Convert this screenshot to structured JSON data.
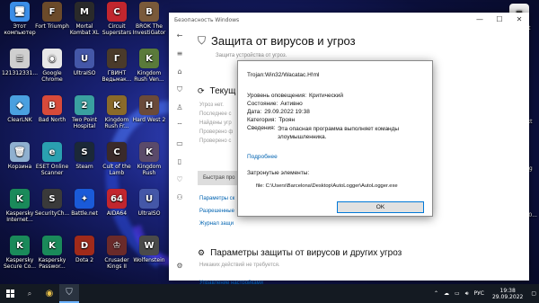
{
  "desktop_icons": [
    {
      "label": "Этот компьютер",
      "glyph": "🖥",
      "color": "#3b8ee8"
    },
    {
      "label": "Fort Triumph",
      "glyph": "F",
      "color": "#6b4a2a"
    },
    {
      "label": "Mortal Kombat XL",
      "glyph": "M",
      "color": "#2a2a2a"
    },
    {
      "label": "Circuit Superstars",
      "glyph": "C",
      "color": "#c2262e"
    },
    {
      "label": "BROK The InvestiGator",
      "glyph": "B",
      "color": "#7a5a3a"
    },
    {
      "label": "121312331...",
      "glyph": "≡",
      "color": "#cfcfcf"
    },
    {
      "label": "Google Chrome",
      "glyph": "◉",
      "color": "#e8e8e8"
    },
    {
      "label": "UltraISO",
      "glyph": "U",
      "color": "#4457a8"
    },
    {
      "label": "ГВИНТ Ведьмак...",
      "glyph": "Г",
      "color": "#4a3a2a"
    },
    {
      "label": "Kingdom Rush Ven...",
      "glyph": "K",
      "color": "#5a7a3a"
    },
    {
      "label": "ClearLNK",
      "glyph": "◆",
      "color": "#4aa0e0"
    },
    {
      "label": "Bad North",
      "glyph": "B",
      "color": "#d84a3a"
    },
    {
      "label": "Two Point Hospital",
      "glyph": "2",
      "color": "#3aa0a0"
    },
    {
      "label": "Kingdom Rush Fr...",
      "glyph": "K",
      "color": "#8a6a2a"
    },
    {
      "label": "Hard West 2",
      "glyph": "H",
      "color": "#6a4a3a"
    },
    {
      "label": "Корзина",
      "glyph": "🗑",
      "color": "#8fb0d0"
    },
    {
      "label": "ESET Online Scanner",
      "glyph": "e",
      "color": "#2aa0b0"
    },
    {
      "label": "Steam",
      "glyph": "S",
      "color": "#1b2838"
    },
    {
      "label": "Cult of the Lamb",
      "glyph": "C",
      "color": "#3a2a2a"
    },
    {
      "label": "Kingdom Rush",
      "glyph": "K",
      "color": "#5a4a6a"
    },
    {
      "label": "Kaspersky Internet...",
      "glyph": "K",
      "color": "#1a8a5a"
    },
    {
      "label": "SecurityCh...",
      "glyph": "S",
      "color": "#3a3a3a"
    },
    {
      "label": "Battle.net",
      "glyph": "✦",
      "color": "#1a5ad8"
    },
    {
      "label": "AIDA64",
      "glyph": "64",
      "color": "#c2262e"
    },
    {
      "label": "UltraISO",
      "glyph": "U",
      "color": "#4457a8"
    },
    {
      "label": "Kaspersky Secure Co...",
      "glyph": "K",
      "color": "#1a8a5a"
    },
    {
      "label": "Kaspersky Passwor...",
      "glyph": "K",
      "color": "#1a8a5a"
    },
    {
      "label": "Dota 2",
      "glyph": "D",
      "color": "#a02a1a"
    },
    {
      "label": "Crusader Kings II",
      "glyph": "♔",
      "color": "#6a2a2a"
    },
    {
      "label": "Wolfenstein",
      "glyph": "W",
      "color": "#4a4a4a"
    }
  ],
  "right_icons": [
    {
      "label": "вход.txt",
      "glyph": "≡"
    },
    {
      "label": "тир.txt",
      "glyph": "≡"
    },
    {
      "label": "магия.txt",
      "glyph": "≡"
    },
    {
      "label": "алекс.jpg",
      "glyph": "▣"
    },
    {
      "label": "78de56d50...",
      "glyph": "▣"
    },
    {
      "label": "333.jpg",
      "glyph": "▣"
    }
  ],
  "security_window": {
    "title": "Безопасность Windows",
    "heading": "Защита от вирусов и угроз",
    "subtitle": "Защита устройства от угроз.",
    "current_threats": "Текущ",
    "lines": [
      "Угроз нет.",
      "Последнее с",
      "Найдены угр",
      "Проверено ф",
      "Проверено с"
    ],
    "quick_scan": "Быстрая про",
    "links": [
      "Параметры ск",
      "Разрешенные",
      "Журнал защи"
    ],
    "settings_heading": "Параметры защиты от вирусов и других угроз",
    "settings_sub": "Никаких действий не требуется.",
    "manage_link": "Управление настройками"
  },
  "dialog": {
    "threat_name": "Trojan:Win32/Wacatac.H!ml",
    "alert_level_label": "Уровень оповещения:",
    "alert_level_value": "Критический",
    "status_label": "Состояние:",
    "status_value": "Активно",
    "date_label": "Дата:",
    "date_value": "29.09.2022 19:38",
    "category_label": "Категория:",
    "category_value": "Троян",
    "details_label": "Сведения:",
    "details_value": "Эта опасная программа выполняет команды злоумышленника.",
    "more_link": "Подробнее",
    "affected_label": "Затронутые элементы:",
    "file_path": "file: C:\\Users\\Barcelona\\Desktop\\AutoLogger\\AutoLogger.exe",
    "ok_label": "OK"
  },
  "taskbar": {
    "lang": "РУС",
    "time": "19:38",
    "date": "29.09.2022"
  }
}
